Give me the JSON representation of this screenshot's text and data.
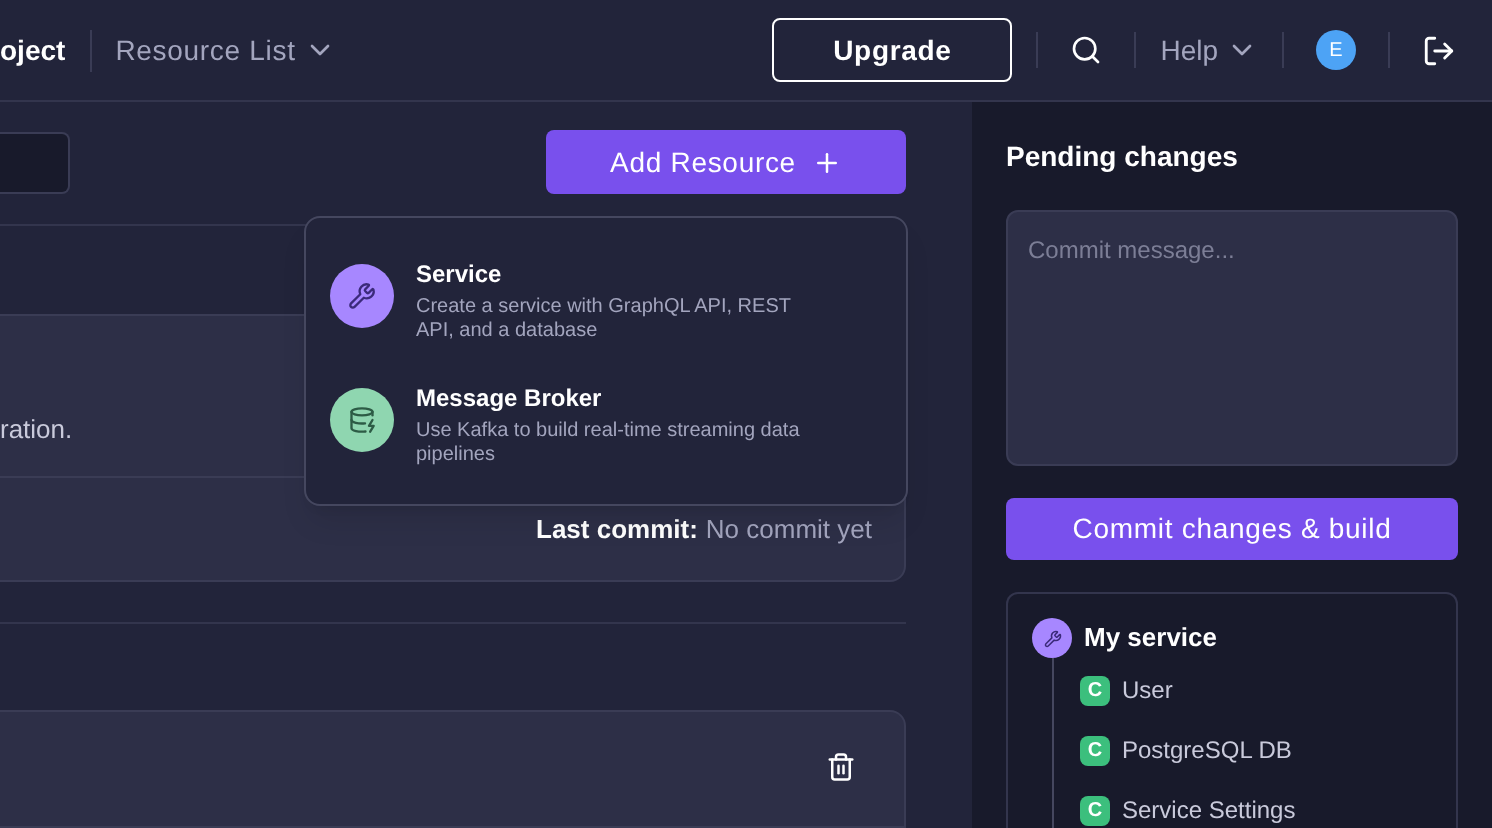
{
  "header": {
    "project": "oject",
    "nav": "Resource List",
    "upgrade": "Upgrade",
    "help": "Help",
    "avatar": "E"
  },
  "toolbar": {
    "add_button": "Add Resource"
  },
  "menu": [
    {
      "kind": "service",
      "title": "Service",
      "description": "Create a service with GraphQL API, REST API, and a database"
    },
    {
      "kind": "broker",
      "title": "Message Broker",
      "description": "Use Kafka to build real-time streaming data pipelines"
    }
  ],
  "card": {
    "text": "ration.",
    "last_commit_label": "Last commit:",
    "last_commit_value": "No commit yet"
  },
  "pending": {
    "title": "Pending changes",
    "placeholder": "Commit message...",
    "commit_button": "Commit changes & build",
    "service": "My service",
    "changes": [
      {
        "badge": "C",
        "name": "User"
      },
      {
        "badge": "C",
        "name": "PostgreSQL DB"
      },
      {
        "badge": "C",
        "name": "Service Settings"
      }
    ]
  }
}
